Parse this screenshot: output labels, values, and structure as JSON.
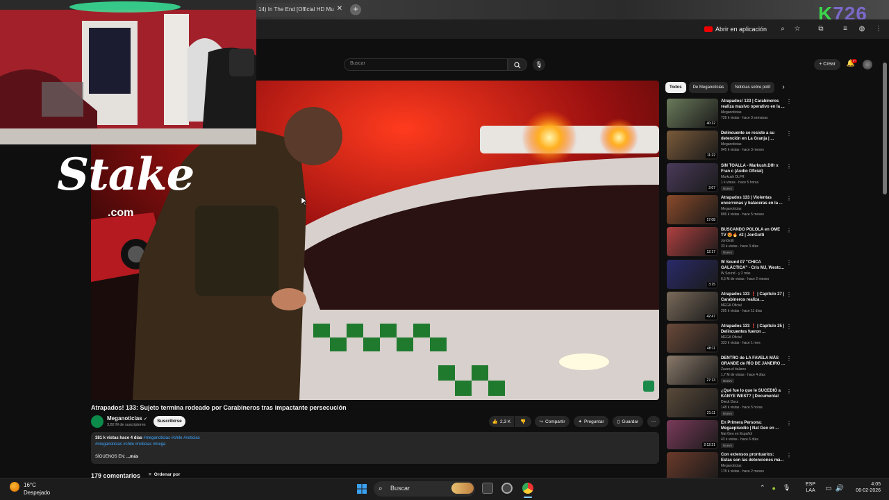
{
  "browser": {
    "tab_title": "14) In The End [Official HD Mu",
    "tab_close": "✕",
    "new_tab": "+",
    "open_in_app": "Abrir en aplicación",
    "overlay_brand_k": "K",
    "overlay_brand_num": "726"
  },
  "youtube": {
    "search_placeholder": "Buscar",
    "create_label": "Crear",
    "bell_badge": "9+"
  },
  "overlay": {
    "stake_name": "Stake",
    "stake_domain": ".com"
  },
  "video": {
    "title": "Atrapados! 133: Sujeto termina rodeado por Carabineros tras impactante persecución",
    "channel": "Meganoticias",
    "subscribers": "3,82 M de suscriptores",
    "subscribe_label": "Suscribirse",
    "likes": "2,3 K",
    "share_label": "Compartir",
    "ask_label": "Preguntar",
    "save_label": "Guardar",
    "desc_views": "381 k vistas  hace 4 días",
    "desc_tags1": "#meganoticias #chile #noticias",
    "desc_tags2": "#meganoticias #chile #noticias #mega",
    "desc_follow": "SÍGUENOS EN:",
    "desc_more": "...más",
    "comments_count": "179 comentarios",
    "sort_label": "Ordenar por"
  },
  "sidebar": {
    "chips": [
      "Todos",
      "De Meganoticias",
      "Noticias sobre polít"
    ],
    "items": [
      {
        "title": "Atrapados! 133 | Carabineros realiza masivo operativo en la ...",
        "channel": "Meganoticias",
        "meta": "728 k vistas · hace 3 semanas",
        "duration": "40:12",
        "badge": ""
      },
      {
        "title": "Delincuente se resiste a su detención en La Granja | ...",
        "channel": "Meganoticias",
        "meta": "945 k vistas · hace 3 meses",
        "duration": "11:22",
        "badge": ""
      },
      {
        "title": "SIN TOALLA - Markush.Dlfr x Fran c (Audio Oficial)",
        "channel": "Markush DLFR",
        "meta": "1 k vistas · hace 5 horas",
        "duration": "2:07",
        "badge": "Nuevo"
      },
      {
        "title": "Atrapados 133 | Violentas encerronas y balaceras en la ...",
        "channel": "Meganoticias",
        "meta": "896 k vistas · hace 5 meses",
        "duration": "17:08",
        "badge": ""
      },
      {
        "title": "BUSCANDO POLOLA en OME TV 😍🔥 #2 | JonGotti",
        "channel": "JonGotti",
        "meta": "33 k vistas · hace 3 días",
        "duration": "12:17",
        "badge": "Nuevo"
      },
      {
        "title": "W Sound 07 \"CHICA GALÁCTICA\" - Cris MJ, Westc...",
        "channel": "W Sound · y 2 más",
        "meta": "6,5 M de vistas · hace 2 meses",
        "duration": "3:15",
        "badge": ""
      },
      {
        "title": "Atrapados 133 ❗ | Capítulo 27 | Carabineros realiza ...",
        "channel": "MEGA Oficial",
        "meta": "205 k vistas · hace 11 días",
        "duration": "42:47",
        "badge": ""
      },
      {
        "title": "Atrapados 133 ❗ | Capítulo 25 | Delincuentes fueron ...",
        "channel": "MEGA Oficial",
        "meta": "333 k vistas · hace 1 mes",
        "duration": "48:11",
        "badge": ""
      },
      {
        "title": "DENTRO de LA FAVELA MÁS GRANDE de RÍO DE JANEIRO ...",
        "channel": "Zazza el italiano",
        "meta": "1,7 M de vistas · hace 4 días",
        "duration": "27:13",
        "badge": "Nuevo"
      },
      {
        "title": "¿Qué fue lo que le SUCEDIÓ a KANYE WEST? | Documental",
        "channel": "Dieck Docs",
        "meta": "148 k vistas · hace 5 horas",
        "duration": "21:11",
        "badge": "Nuevo"
      },
      {
        "title": "En Primera Persona: Megaepisodio | Nat Geo en ...",
        "channel": "Nat Geo en Español",
        "meta": "43 k vistas · hace 6 días",
        "duration": "2:12:21",
        "badge": "Nuevo"
      },
      {
        "title": "Con extensos prontuarios: Estas son las detenciones má...",
        "channel": "Meganoticias",
        "meta": "178 k vistas · hace 2 meses",
        "duration": "",
        "badge": ""
      }
    ]
  },
  "taskbar": {
    "temperature": "16°C",
    "condition": "Despejado",
    "search_label": "Buscar",
    "lang1": "ESP",
    "lang2": "LAA",
    "time": "4:05",
    "date": "06-02-2026"
  }
}
